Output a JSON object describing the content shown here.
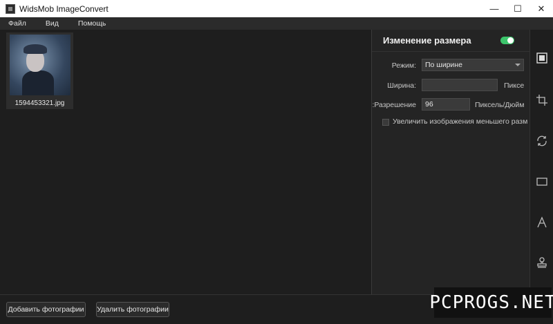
{
  "window": {
    "title": "WidsMob ImageConvert",
    "controls": {
      "minimize": "—",
      "maximize": "☐",
      "close": "✕"
    }
  },
  "menu": [
    "Файл",
    "Вид",
    "Помощь"
  ],
  "gallery": {
    "items": [
      {
        "filename": "1594453321.jpg"
      }
    ]
  },
  "panel": {
    "title": "Изменение размера",
    "enabled": true,
    "accent_color": "#3cc46b",
    "mode_label": "Режим:",
    "mode_value": "По ширине",
    "width_label": "Ширина:",
    "width_value": "",
    "width_unit": "Пиксе",
    "resolution_label": "Разрешение:",
    "resolution_value": "96",
    "resolution_unit": "Пиксель/Дюйм",
    "enlarge_label": "Увеличить изображения меньшего разм",
    "enlarge_checked": false
  },
  "tools": [
    {
      "icon": "resize-icon",
      "active": true
    },
    {
      "icon": "crop-icon"
    },
    {
      "icon": "rotate-icon"
    },
    {
      "icon": "frame-icon"
    },
    {
      "icon": "text-watermark-icon"
    },
    {
      "icon": "stamp-icon"
    }
  ],
  "bottom": {
    "add_photos": "Добавить фотографии",
    "remove_photos": "Удалить фотографии"
  },
  "watermark": "PCPROGS.NET"
}
